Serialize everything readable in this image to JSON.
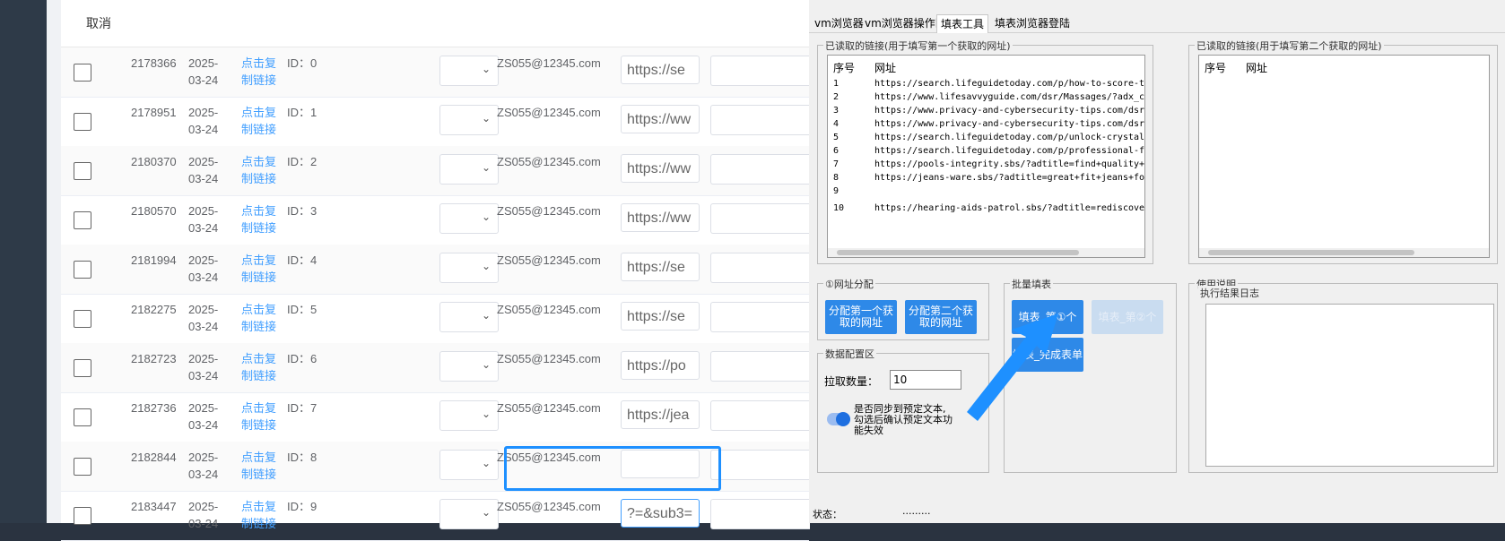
{
  "web": {
    "cancel_label": "取消",
    "rows": [
      {
        "id": "2178366",
        "date": "2025-03-24",
        "link": "点击复制链接",
        "rid": "ID：0",
        "email": "ZS055@12345.com",
        "url": "https://se"
      },
      {
        "id": "2178951",
        "date": "2025-03-24",
        "link": "点击复制链接",
        "rid": "ID：1",
        "email": "ZS055@12345.com",
        "url": "https://ww"
      },
      {
        "id": "2180370",
        "date": "2025-03-24",
        "link": "点击复制链接",
        "rid": "ID：2",
        "email": "ZS055@12345.com",
        "url": "https://ww"
      },
      {
        "id": "2180570",
        "date": "2025-03-24",
        "link": "点击复制链接",
        "rid": "ID：3",
        "email": "ZS055@12345.com",
        "url": "https://ww"
      },
      {
        "id": "2181994",
        "date": "2025-03-24",
        "link": "点击复制链接",
        "rid": "ID：4",
        "email": "ZS055@12345.com",
        "url": "https://se"
      },
      {
        "id": "2182275",
        "date": "2025-03-24",
        "link": "点击复制链接",
        "rid": "ID：5",
        "email": "ZS055@12345.com",
        "url": "https://se"
      },
      {
        "id": "2182723",
        "date": "2025-03-24",
        "link": "点击复制链接",
        "rid": "ID：6",
        "email": "ZS055@12345.com",
        "url": "https://po"
      },
      {
        "id": "2182736",
        "date": "2025-03-24",
        "link": "点击复制链接",
        "rid": "ID：7",
        "email": "ZS055@12345.com",
        "url": "https://jea"
      },
      {
        "id": "2182844",
        "date": "2025-03-24",
        "link": "点击复制链接",
        "rid": "ID：8",
        "email": "ZS055@12345.com",
        "url": ""
      },
      {
        "id": "2183447",
        "date": "2025-03-24",
        "link": "点击复制链接",
        "rid": "ID：9",
        "email": "ZS055@12345.com",
        "url": "?=&sub3="
      }
    ]
  },
  "tool": {
    "tabs": [
      "vm浏览器",
      "vm浏览器操作区",
      "填表工具",
      "填表浏览器登陆"
    ],
    "active_tab": "填表工具",
    "list1_title": "已读取的链接(用于填写第一个获取的网址)",
    "list2_title": "已读取的链接(用于填写第二个获取的网址)",
    "col_seq": "序号",
    "col_url": "网址",
    "list1_rows": [
      {
        "n": "1",
        "u": "https://search.lifeguidetoday.com/p/how-to-score-the-b"
      },
      {
        "n": "2",
        "u": "https://www.lifesavvyguide.com/dsr/Massages/?adx_chann"
      },
      {
        "n": "3",
        "u": "https://www.privacy-and-cybersecurity-tips.com/dsr/Ele"
      },
      {
        "n": "4",
        "u": "https://www.privacy-and-cybersecurity-tips.com/dsr/Adv"
      },
      {
        "n": "5",
        "u": "https://search.lifeguidetoday.com/p/unlock-crystal-cle"
      },
      {
        "n": "6",
        "u": "https://search.lifeguidetoday.com/p/professional-fence"
      },
      {
        "n": "7",
        "u": "https://pools-integrity.sbs/?adtitle=find+quality+smal"
      },
      {
        "n": "8",
        "u": "https://jeans-ware.sbs/?adtitle=great+fit+jeans+for+ev"
      },
      {
        "n": "9",
        "u": ""
      },
      {
        "n": "10",
        "u": "https://hearing-aids-patrol.sbs/?adtitle=rediscover+li"
      }
    ],
    "alloc_title": "①网址分配",
    "alloc_btn1": "分配第一个获取的网址",
    "alloc_btn2": "分配第二个获取的网址",
    "batch_title": "批量填表",
    "fill_btn1": "填表_第①个",
    "fill_btn2": "填表_第②个",
    "fill_done": "填表_完成表单",
    "config_title": "数据配置区",
    "pull_label": "拉取数量：",
    "pull_value": "10",
    "sync_label": "是否同步到预定文本,勾选后确认预定文本功能失效",
    "usage_title": "使用说明",
    "log_title": "执行结果日志",
    "status_label": "状态：",
    "status_value": "........."
  }
}
